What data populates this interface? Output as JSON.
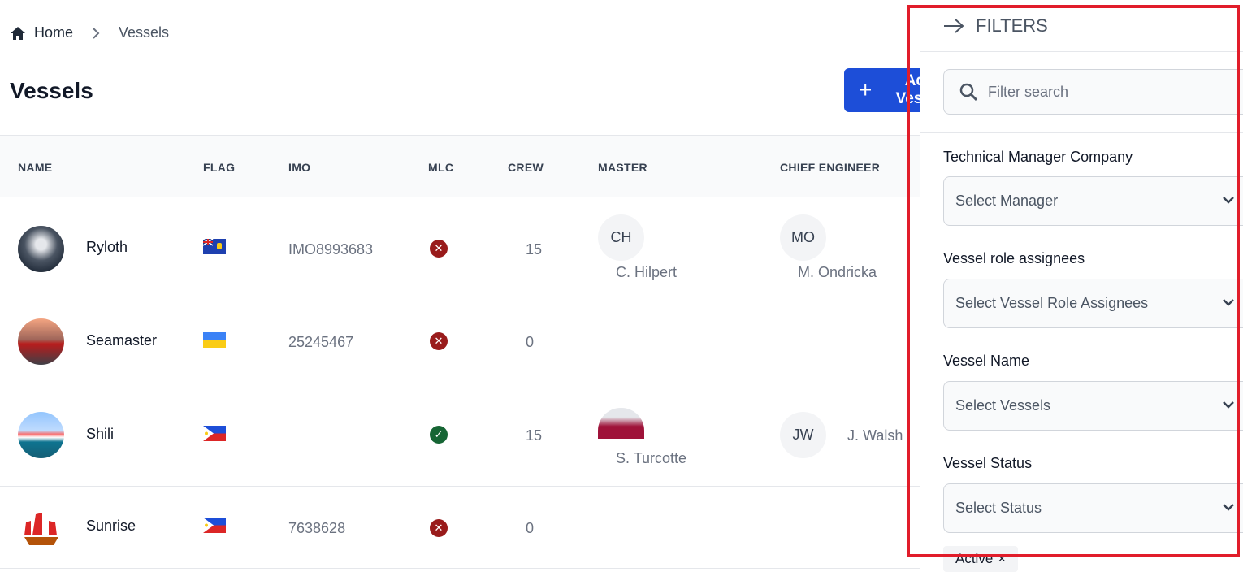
{
  "breadcrumb": {
    "home": "Home",
    "current": "Vessels",
    "home_icon": "home-icon",
    "separator_icon": "chevron-right-icon"
  },
  "page_title": "Vessels",
  "add_button": {
    "label": "Add Vessel",
    "icon": "plus-icon",
    "color": "#1d4ed8"
  },
  "table": {
    "columns": [
      "NAME",
      "FLAG",
      "IMO",
      "MLC",
      "CREW",
      "MASTER",
      "CHIEF ENGINEER"
    ],
    "rows": [
      {
        "name": "Ryloth",
        "flag": "saint-helena",
        "imo": "IMO8993683",
        "mlc": "invalid",
        "crew": "15",
        "master_initials": "CH",
        "master": "C. Hilpert",
        "chief_initials": "MO",
        "chief": "M. Ondricka"
      },
      {
        "name": "Seamaster",
        "flag": "ukraine",
        "imo": "25245467",
        "mlc": "invalid",
        "crew": "0"
      },
      {
        "name": "Shili",
        "flag": "philippines",
        "imo": "",
        "mlc": "valid",
        "crew": "15",
        "master": "S. Turcotte",
        "chief_initials": "JW",
        "chief": "J. Walsh"
      },
      {
        "name": "Sunrise",
        "flag": "philippines",
        "imo": "7638628",
        "mlc": "invalid",
        "crew": "0"
      }
    ]
  },
  "filters": {
    "title": "FILTERS",
    "search_placeholder": "Filter search",
    "technical_manager": {
      "label": "Technical Manager Company",
      "placeholder": "Select Manager"
    },
    "role_assignees": {
      "label": "Vessel role assignees",
      "placeholder": "Select Vessel Role Assignees"
    },
    "vessel_name": {
      "label": "Vessel Name",
      "placeholder": "Select Vessels"
    },
    "vessel_status": {
      "label": "Vessel Status",
      "placeholder": "Select Status",
      "selected": "Active",
      "remove": "×"
    }
  },
  "colors": {
    "invalid": "#991b1b",
    "valid": "#166534",
    "highlight": "#e11d2a"
  }
}
